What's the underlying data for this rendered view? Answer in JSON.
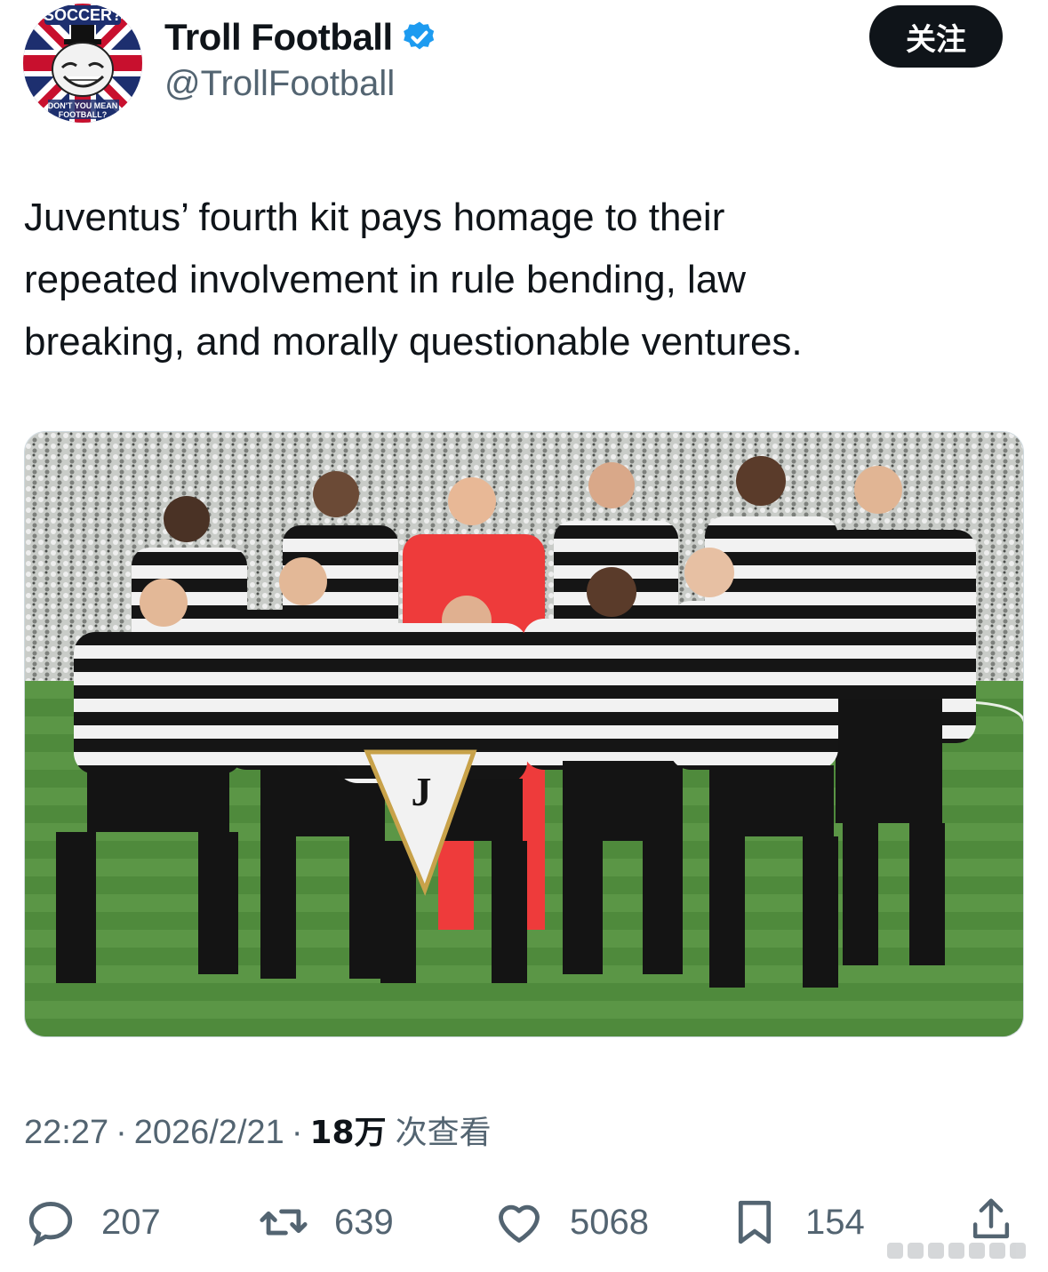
{
  "user": {
    "display_name": "Troll Football",
    "handle": "@TrollFootball",
    "verified": true,
    "avatar_top_text": "SOCCER?",
    "avatar_bottom_text": "DON'T YOU MEAN FOOTBALL?"
  },
  "follow_button": {
    "label": "关注"
  },
  "tweet": {
    "text_lines": [
      "Juventus’ fourth kit pays homage to their",
      "repeated involvement in rule bending, law",
      "breaking, and morally questionable ventures."
    ]
  },
  "meta": {
    "time": "22:27",
    "separator": "·",
    "date": "2026/2/21",
    "views_count": "18万",
    "views_label": "次查看"
  },
  "actions": {
    "replies": "207",
    "retweets": "639",
    "likes": "5068",
    "bookmarks": "154"
  },
  "colors": {
    "text_primary": "#0f1419",
    "text_secondary": "#536471",
    "verified_blue": "#1d9bf0",
    "follow_bg": "#0f1419"
  },
  "icons": [
    "verified-badge-icon",
    "reply-icon",
    "retweet-icon",
    "like-icon",
    "bookmark-icon",
    "share-icon"
  ]
}
